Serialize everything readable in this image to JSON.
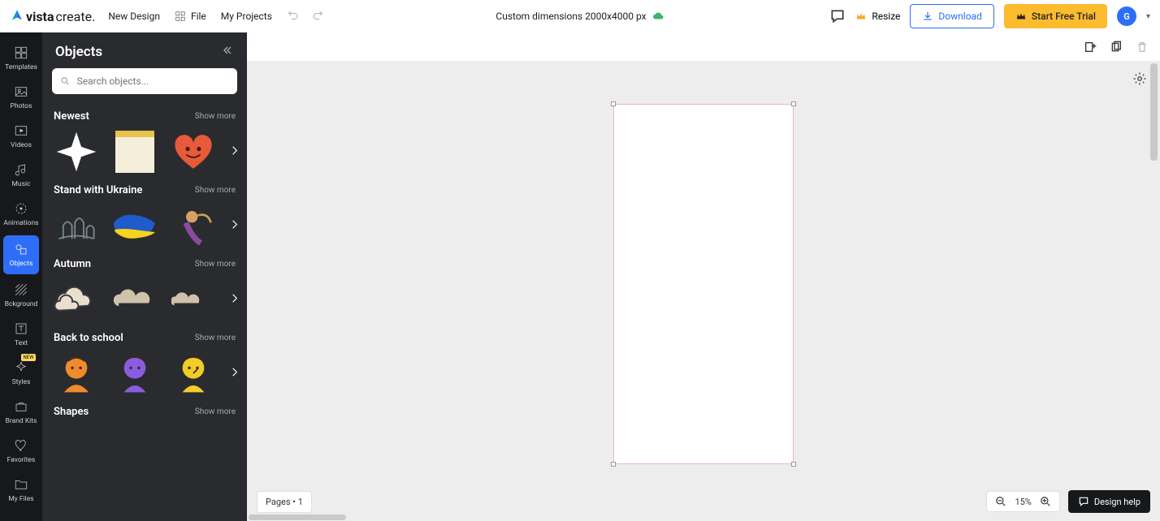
{
  "header": {
    "brand_prefix": "vista",
    "brand_suffix": "create.",
    "new_design": "New Design",
    "file": "File",
    "my_projects": "My Projects",
    "doc_title": "Custom dimensions 2000x4000 px",
    "resize": "Resize",
    "download": "Download",
    "trial": "Start Free Trial",
    "avatar_letter": "G"
  },
  "rail": {
    "templates": "Templates",
    "photos": "Photos",
    "videos": "Videos",
    "music": "Music",
    "animations": "Animations",
    "objects": "Objects",
    "background": "Bckground",
    "text": "Text",
    "styles": "Styles",
    "styles_badge": "NEW",
    "brand_kits": "Brand Kits",
    "favorites": "Favorites",
    "my_files": "My Files"
  },
  "panel": {
    "title": "Objects",
    "search_placeholder": "Search objects...",
    "show_more": "Show more",
    "cat1": "Newest",
    "cat2": "Stand with Ukraine",
    "cat3": "Autumn",
    "cat4": "Back to school",
    "cat5": "Shapes"
  },
  "bottom": {
    "pages": "Pages • 1",
    "zoom": "15%",
    "help": "Design help"
  }
}
